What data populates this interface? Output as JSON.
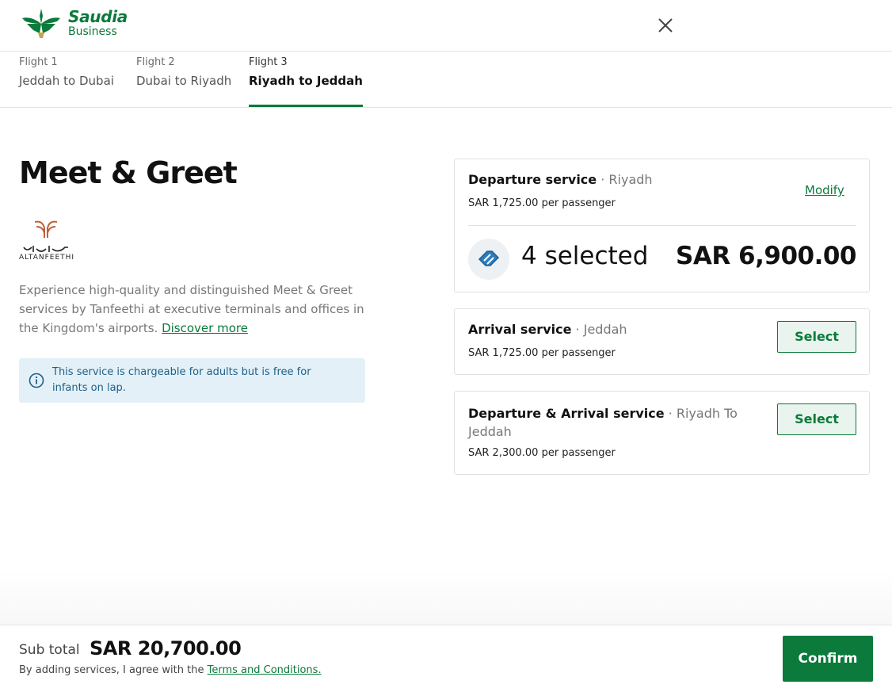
{
  "header": {
    "brand": "Saudia",
    "brand_sub": "Business",
    "close_icon": "close-icon"
  },
  "tabs": [
    {
      "sub": "Flight 1",
      "label": "Jeddah to Dubai",
      "active": false
    },
    {
      "sub": "Flight 2",
      "label": "Dubai to Riyadh",
      "active": false
    },
    {
      "sub": "Flight 3",
      "label": "Riyadh to Jeddah",
      "active": true
    }
  ],
  "main": {
    "title": "Meet & Greet",
    "partner_name": "ALTANFEETHI",
    "description": "Experience high-quality and distinguished Meet & Greet services by Tanfeethi at executive terminals and offices in the Kingdom's airports.",
    "discover_more": "Discover more",
    "info": "This service is chargeable for adults but is free for infants on lap."
  },
  "services": [
    {
      "title": "Departure service",
      "location": "· Riyadh",
      "price": "SAR 1,725.00 per passenger",
      "modify_label": "Modify",
      "selected_label": "4 selected",
      "selected_total": "SAR 6,900.00"
    },
    {
      "title": "Arrival service",
      "location": "· Jeddah",
      "price": "SAR 1,725.00 per passenger",
      "select_label": "Select"
    },
    {
      "title": "Departure & Arrival service",
      "location": "· Riyadh To Jeddah",
      "price": "SAR 2,300.00 per passenger",
      "select_label": "Select"
    }
  ],
  "footer": {
    "subtotal_label": "Sub total",
    "subtotal_value": "SAR 20,700.00",
    "agree_text": "By adding services, I agree with the",
    "terms_label": "Terms and Conditions.",
    "confirm_label": "Confirm"
  },
  "colors": {
    "brand_green": "#0b7a3b",
    "info_bg": "#e3f0f8",
    "info_text": "#1f5f86"
  }
}
